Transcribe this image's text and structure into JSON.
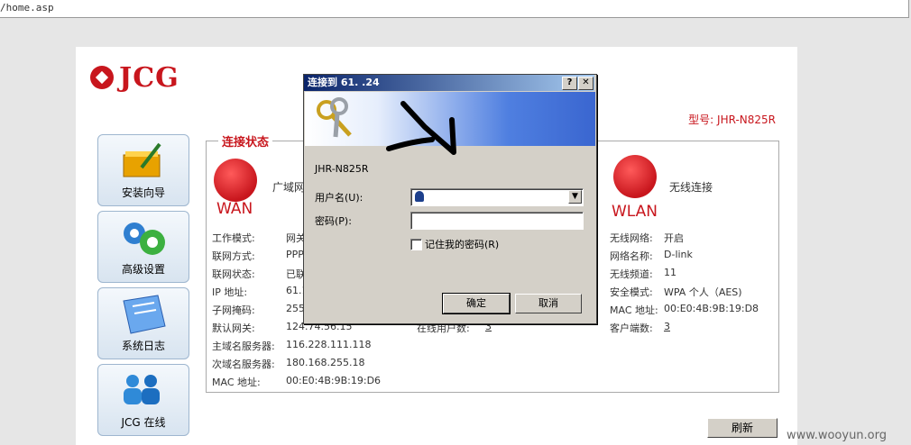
{
  "address_bar": {
    "text": "/home.asp"
  },
  "brand": {
    "logo_text": "JCG",
    "model_label": "型号: JHR-N825R"
  },
  "nav": [
    {
      "label": "安装向导",
      "icon": "folder-pencil-icon"
    },
    {
      "label": "高级设置",
      "icon": "gears-icon"
    },
    {
      "label": "系统日志",
      "icon": "document-icon"
    },
    {
      "label": "JCG 在线",
      "icon": "people-icon"
    }
  ],
  "status": {
    "title": "连接状态",
    "wan_label": "WAN",
    "wan_desc": "广域网",
    "wan_rows": [
      {
        "key": "工作模式:",
        "value": "网关"
      },
      {
        "key": "联网方式:",
        "value": "PPP"
      },
      {
        "key": "联网状态:",
        "value": "已联"
      },
      {
        "key": "IP 地址:",
        "value": "61.1"
      },
      {
        "key": "子网掩码:",
        "value": "255"
      },
      {
        "key": "默认网关:",
        "value": "124.74.56.15"
      },
      {
        "key": "主域名服务器:",
        "value": "116.228.111.118"
      },
      {
        "key": "次域名服务器:",
        "value": "180.168.255.18"
      },
      {
        "key": "MAC 地址:",
        "value": "00:E0:4B:9B:19:D6"
      }
    ],
    "online_users_label": "在线用户数:",
    "online_users_value": "3",
    "wlan_label": "WLAN",
    "wlan_desc": "无线连接",
    "wlan_rows": [
      {
        "key": "无线网络:",
        "value": "开启"
      },
      {
        "key": "网络名称:",
        "value": "D-link"
      },
      {
        "key": "无线频道:",
        "value": "11"
      },
      {
        "key": "安全模式:",
        "value": "WPA 个人（AES)"
      },
      {
        "key": "MAC 地址:",
        "value": "00:E0:4B:9B:19:D8"
      },
      {
        "key": "客户端数:",
        "value": "3"
      }
    ]
  },
  "refresh_label": "刷新",
  "dialog": {
    "title": "连接到 61.     .24",
    "help": "?",
    "close": "✕",
    "realm": "JHR-N825R",
    "username_label": "用户名(U):",
    "password_label": "密码(P):",
    "remember_label": "记住我的密码(R)",
    "ok": "确定",
    "cancel": "取消"
  },
  "watermark": "www.wooyun.org"
}
